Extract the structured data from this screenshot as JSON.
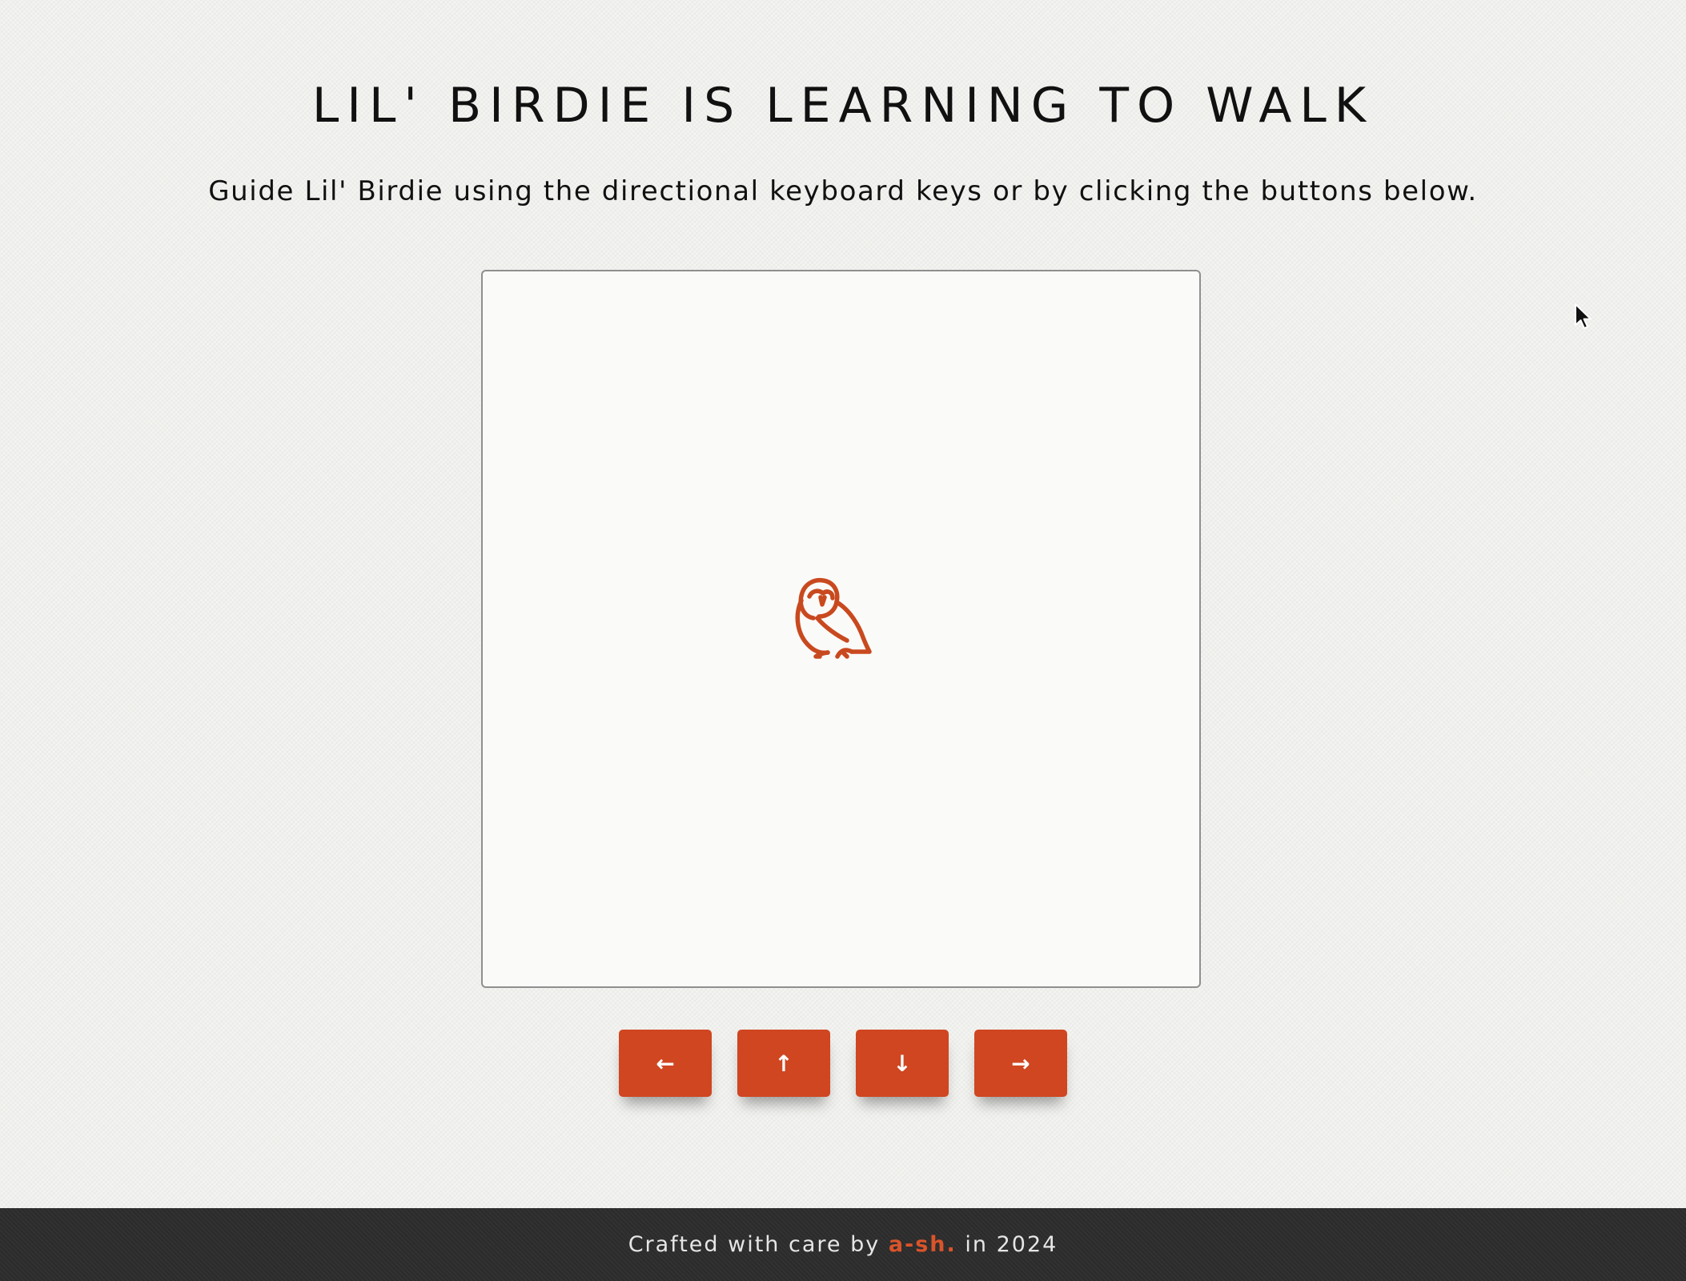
{
  "header": {
    "title": "LIL' BIRDIE IS LEARNING TO WALK",
    "subtitle": "Guide Lil' Birdie using the directional keyboard keys or by clicking the buttons below."
  },
  "board": {
    "character_icon": "owl-icon",
    "character_color": "#c9491f"
  },
  "controls": {
    "left_label": "←",
    "up_label": "↑",
    "down_label": "↓",
    "right_label": "→",
    "button_color": "#cf4621"
  },
  "footer": {
    "prefix": "Crafted with care by",
    "brand": "a-sh.",
    "suffix": "in 2024",
    "brand_color": "#d9542a"
  }
}
